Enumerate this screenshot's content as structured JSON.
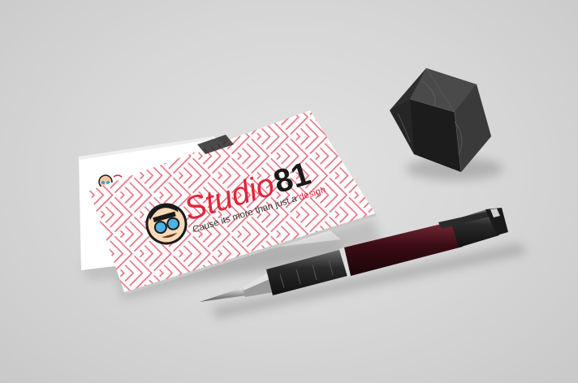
{
  "brand": {
    "name_part1": "Studio",
    "name_part2": "81",
    "tagline_part1": "Cause its more than just a ",
    "tagline_part2": "design"
  },
  "colors": {
    "background": "#d9d9d9",
    "card_front": "#ffffff",
    "pattern_line": "#e56a7a",
    "brand_red": "#e0263a",
    "brand_dark": "#1a1a1a",
    "pen_body": "#3a0c14",
    "pen_grip": "#222222",
    "cube": "#2b2b2b"
  },
  "objects": {
    "back_card": "business-card-back",
    "front_card": "business-card-front",
    "logo_icon": "mascot-with-glasses-icon",
    "pen": "ballpoint-pen",
    "cube": "marble-polyhedron"
  }
}
